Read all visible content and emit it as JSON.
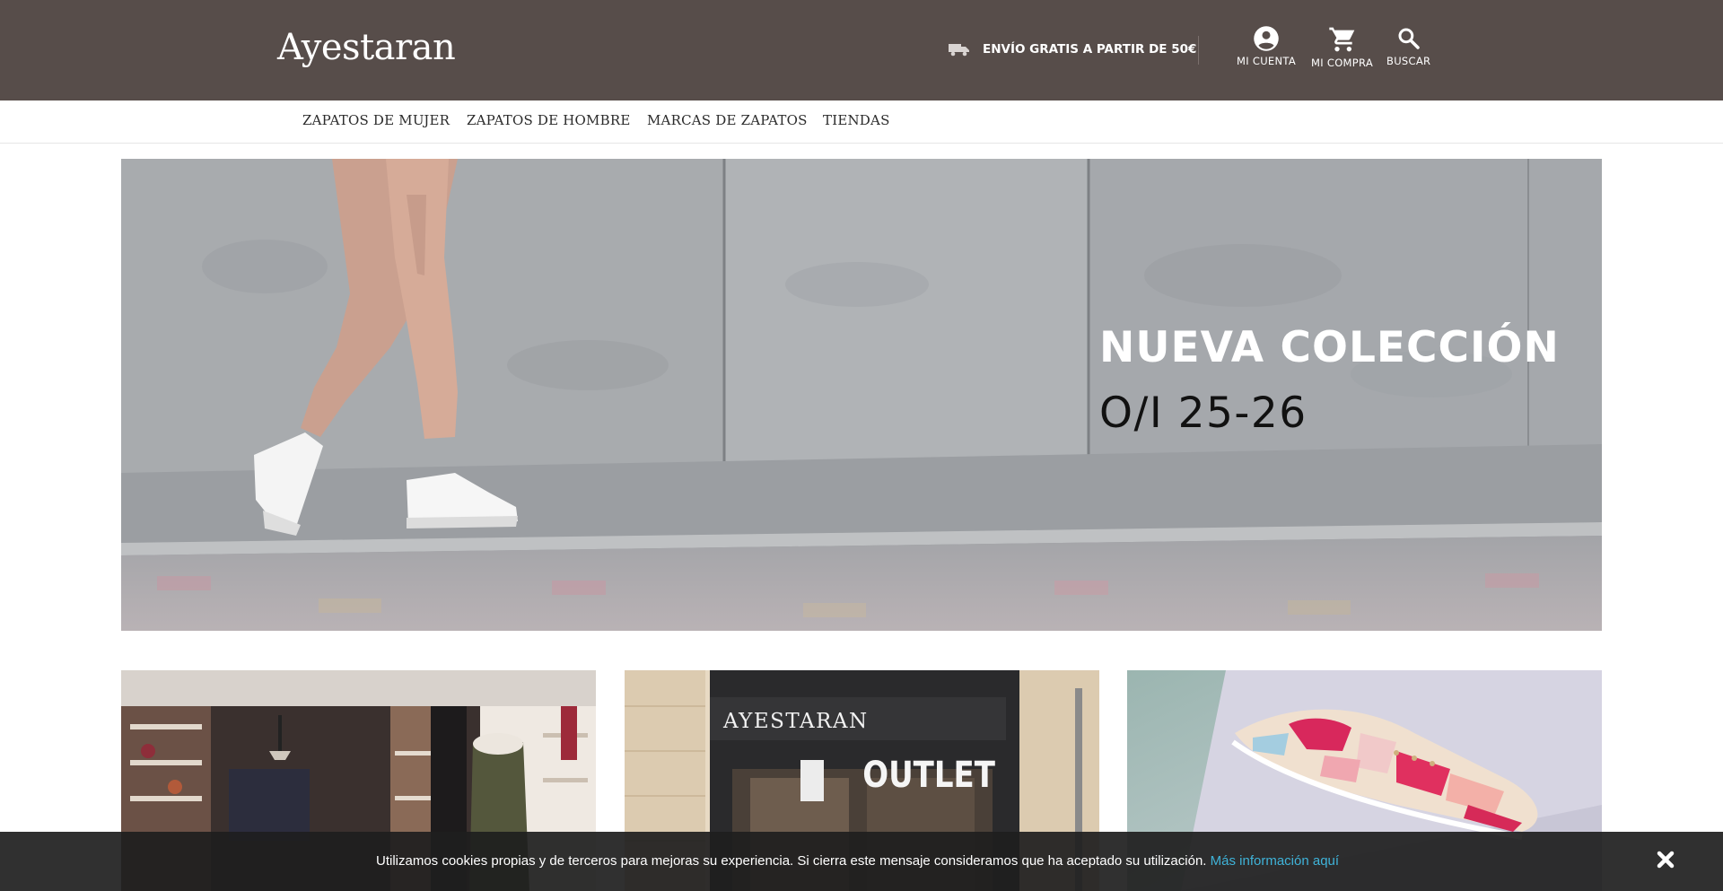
{
  "header": {
    "logo": "Ayestaran",
    "shipping_text": "ENVÍO GRATIS A PARTIR DE 50€",
    "account_label": "MI CUENTA",
    "cart_label": "MI COMPRA",
    "search_label": "BUSCAR"
  },
  "nav": {
    "items": [
      {
        "label": "ZAPATOS DE MUJER"
      },
      {
        "label": "ZAPATOS DE HOMBRE"
      },
      {
        "label": "MARCAS DE ZAPATOS"
      },
      {
        "label": "TIENDAS"
      }
    ]
  },
  "hero": {
    "title": "NUEVA COLECCIÓN",
    "subtitle": "O/I 25-26"
  },
  "tiles": {
    "outlet_sign": "AYESTARAN",
    "outlet_text": "OUTLET"
  },
  "cookie": {
    "message": "Utilizamos cookies propias y de terceros para mejoras su experiencia. Si cierra este mensaje consideramos que ha aceptado su utilización.",
    "link_text": "Más información aquí"
  },
  "colors": {
    "header_bg": "#574d4a",
    "cookie_link": "#3fb3d9"
  }
}
